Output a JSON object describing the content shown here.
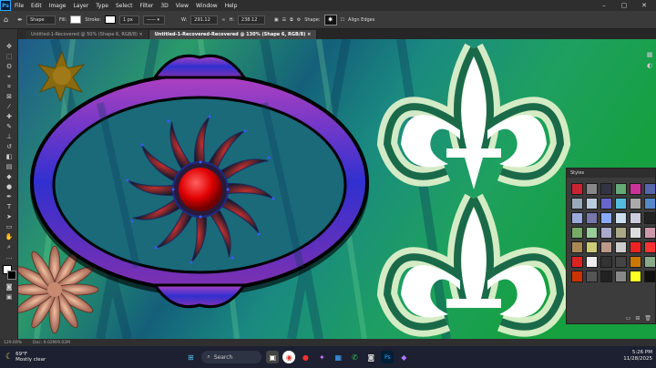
{
  "menu": {
    "logo": "Ps",
    "items": [
      "File",
      "Edit",
      "Image",
      "Layer",
      "Type",
      "Select",
      "Filter",
      "3D",
      "View",
      "Window",
      "Help"
    ]
  },
  "options": {
    "tool_mode": "Shape",
    "fill_label": "Fill:",
    "stroke_label": "Stroke:",
    "stroke_width": "1 px",
    "w_label": "W:",
    "w_value": "291.12",
    "h_label": "H:",
    "h_value": "238.12",
    "shape_label": "Shape:",
    "align_edges": "Align Edges"
  },
  "tabs": [
    {
      "label": "Untitled-1-Recovered @ 50% (Shape 6, RGB/8) ×"
    },
    {
      "label": "Untitled-1-Recovered-Recovered @ 130% (Shape 6, RGB/8) ×"
    }
  ],
  "status": {
    "zoom": "129.69%",
    "doc": "Doc: 9.02M/9.02M"
  },
  "styles_panel": {
    "title": "Styles",
    "colors": [
      "#c23",
      "#888",
      "#334",
      "#6a7",
      "#c39",
      "#56a",
      "#9ab",
      "#bcd",
      "#66c",
      "#5bd",
      "#aaa",
      "#58c",
      "#9ad",
      "#77a",
      "#8af",
      "#cde",
      "#ccd",
      "#222",
      "#7a6",
      "#9c9",
      "#aac",
      "#aa8",
      "#ddd",
      "#c9a",
      "#a85",
      "#cc7",
      "#b98",
      "#ccc",
      "#e22",
      "#f33",
      "#d22",
      "#eee",
      "#333",
      "#444",
      "#c70",
      "#8a8",
      "#c30",
      "#555",
      "#222",
      "#888",
      "#ff2",
      "#111"
    ]
  },
  "taskbar": {
    "temp": "69°F",
    "weather": "Mostly clear",
    "search": "Search",
    "time": "5:26 PM",
    "date": "11/28/2025"
  }
}
